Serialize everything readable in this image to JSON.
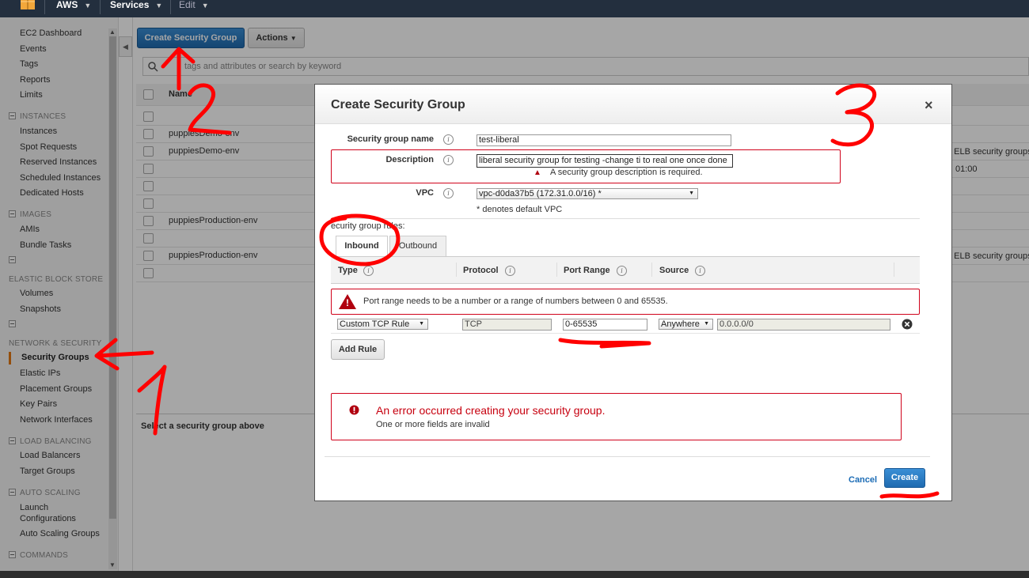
{
  "topnav": {
    "brand": "AWS",
    "services": "Services",
    "edit": "Edit"
  },
  "sidebar": {
    "links_top": [
      "EC2 Dashboard",
      "Events",
      "Tags",
      "Reports",
      "Limits"
    ],
    "sections": [
      {
        "title": "INSTANCES",
        "items": [
          "Instances",
          "Spot Requests",
          "Reserved Instances",
          "Scheduled Instances",
          "Dedicated Hosts"
        ]
      },
      {
        "title": "IMAGES",
        "items": [
          "AMIs",
          "Bundle Tasks"
        ]
      },
      {
        "title": "ELASTIC BLOCK STORE",
        "items": [
          "Volumes",
          "Snapshots"
        ]
      },
      {
        "title": "NETWORK & SECURITY",
        "items": [
          "Security Groups",
          "Elastic IPs",
          "Placement Groups",
          "Key Pairs",
          "Network Interfaces"
        ]
      },
      {
        "title": "LOAD BALANCING",
        "items": [
          "Load Balancers",
          "Target Groups"
        ]
      },
      {
        "title": "AUTO SCALING",
        "items": [
          "Launch Configurations",
          "Auto Scaling Groups"
        ]
      },
      {
        "title": "COMMANDS",
        "items": []
      }
    ]
  },
  "toolbar": {
    "create_sg": "Create Security Group",
    "actions": "Actions"
  },
  "search": {
    "placeholder": "tags and attributes or search by keyword"
  },
  "table": {
    "col_name": "Name",
    "rows": [
      "",
      "puppiesDemo-env",
      "puppiesDemo-env",
      "",
      "",
      "",
      "puppiesProduction-env",
      "",
      "puppiesProduction-env",
      ""
    ],
    "right_texts": [
      "o ELB security groups",
      "01:00",
      "o ELB security groups"
    ]
  },
  "detail": {
    "hint": "Select a security group above"
  },
  "modal": {
    "title": "Create Security Group",
    "close": "×",
    "name_label": "Security group name",
    "name_value": "test-liberal",
    "desc_label": "Description",
    "desc_value": "liberal security group for testing -change ti to real one once done",
    "desc_error": "A security group description is required.",
    "vpc_label": "VPC",
    "vpc_value": "vpc-d0da37b5 (172.31.0.0/16) *",
    "vpc_note": "* denotes default VPC",
    "rules_label": "ecurity group rules:",
    "tabs": [
      "Inbound",
      "Outbound"
    ],
    "columns": [
      "Type",
      "Protocol",
      "Port Range",
      "Source"
    ],
    "port_error": "Port range needs to be a number or a range of numbers between 0 and 65535.",
    "rule": {
      "type": "Custom TCP Rule",
      "protocol": "TCP",
      "port_range": "0-65535",
      "source_type": "Anywhere",
      "source_cidr": "0.0.0.0/0"
    },
    "add_rule": "Add Rule",
    "error_title": "An error occurred creating your security group.",
    "error_detail": "One or more fields are invalid",
    "cancel": "Cancel",
    "create": "Create"
  },
  "colors": {
    "nav_bg": "#232f3e",
    "primary_button": "#1f6bb0",
    "error_red": "#d0021b",
    "annotation_red": "#ff0000"
  }
}
